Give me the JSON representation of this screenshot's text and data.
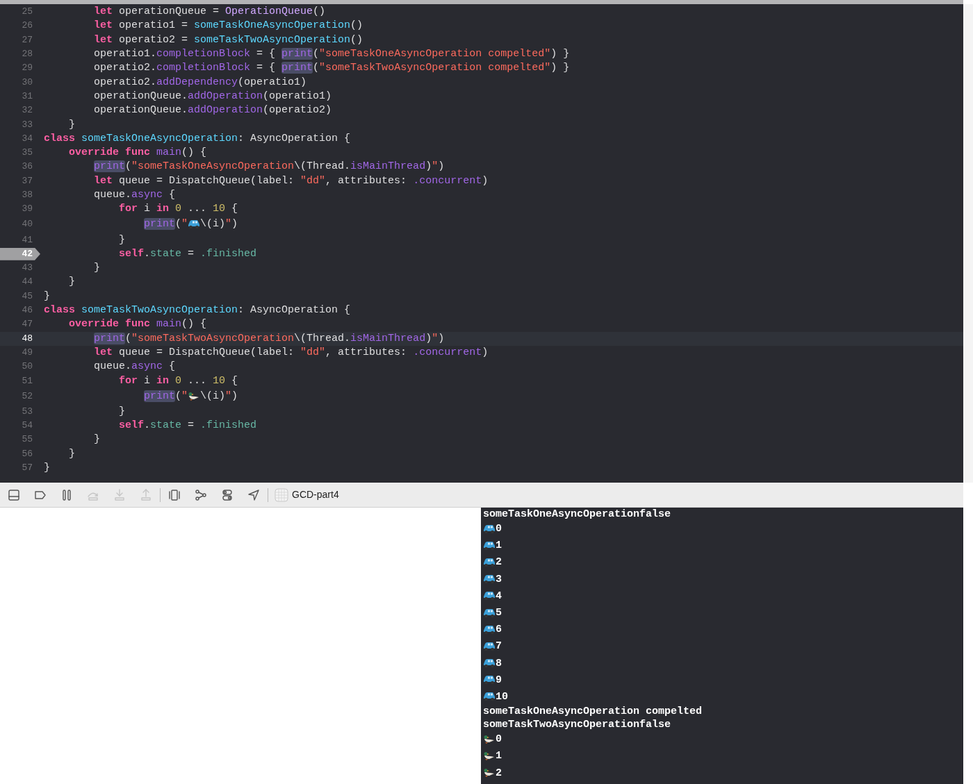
{
  "editor": {
    "lines": [
      {
        "number": "25",
        "breakpoint": false,
        "current": false,
        "tokens": [
          {
            "kind": "k",
            "text": "        let"
          },
          {
            "kind": "p",
            "text": " operationQueue = "
          },
          {
            "kind": "t",
            "text": "OperationQueue"
          },
          {
            "kind": "p",
            "text": "()"
          }
        ]
      },
      {
        "number": "26",
        "breakpoint": false,
        "current": false,
        "tokens": [
          {
            "kind": "k",
            "text": "        let"
          },
          {
            "kind": "p",
            "text": " operatio1 = "
          },
          {
            "kind": "d",
            "text": "someTaskOneAsyncOperation"
          },
          {
            "kind": "p",
            "text": "()"
          }
        ]
      },
      {
        "number": "27",
        "breakpoint": false,
        "current": false,
        "tokens": [
          {
            "kind": "k",
            "text": "        let"
          },
          {
            "kind": "p",
            "text": " operatio2 = "
          },
          {
            "kind": "d",
            "text": "someTaskTwoAsyncOperation"
          },
          {
            "kind": "p",
            "text": "()"
          }
        ]
      },
      {
        "number": "28",
        "breakpoint": false,
        "current": false,
        "tokens": [
          {
            "kind": "p",
            "text": "        operatio1."
          },
          {
            "kind": "f",
            "text": "completionBlock"
          },
          {
            "kind": "p",
            "text": " = { "
          },
          {
            "kind": "h",
            "text": "print"
          },
          {
            "kind": "p",
            "text": "("
          },
          {
            "kind": "s",
            "text": "\"someTaskOneAsyncOperation compelted\""
          },
          {
            "kind": "p",
            "text": ") }"
          }
        ]
      },
      {
        "number": "29",
        "breakpoint": false,
        "current": false,
        "tokens": [
          {
            "kind": "p",
            "text": "        operatio2."
          },
          {
            "kind": "f",
            "text": "completionBlock"
          },
          {
            "kind": "p",
            "text": " = { "
          },
          {
            "kind": "h",
            "text": "print"
          },
          {
            "kind": "p",
            "text": "("
          },
          {
            "kind": "s",
            "text": "\"someTaskTwoAsyncOperation compelted\""
          },
          {
            "kind": "p",
            "text": ") }"
          }
        ]
      },
      {
        "number": "30",
        "breakpoint": false,
        "current": false,
        "tokens": [
          {
            "kind": "p",
            "text": "        operatio2."
          },
          {
            "kind": "f",
            "text": "addDependency"
          },
          {
            "kind": "p",
            "text": "(operatio1)"
          }
        ]
      },
      {
        "number": "31",
        "breakpoint": false,
        "current": false,
        "tokens": [
          {
            "kind": "p",
            "text": "        operationQueue."
          },
          {
            "kind": "f",
            "text": "addOperation"
          },
          {
            "kind": "p",
            "text": "(operatio1)"
          }
        ]
      },
      {
        "number": "32",
        "breakpoint": false,
        "current": false,
        "tokens": [
          {
            "kind": "p",
            "text": "        operationQueue."
          },
          {
            "kind": "f",
            "text": "addOperation"
          },
          {
            "kind": "p",
            "text": "(operatio2)"
          }
        ]
      },
      {
        "number": "33",
        "breakpoint": false,
        "current": false,
        "tokens": [
          {
            "kind": "p",
            "text": "    }"
          }
        ]
      },
      {
        "number": "34",
        "breakpoint": false,
        "current": false,
        "tokens": [
          {
            "kind": "k",
            "text": "class"
          },
          {
            "kind": "d",
            "text": " someTaskOneAsyncOperation"
          },
          {
            "kind": "p",
            "text": ": AsyncOperation {"
          }
        ]
      },
      {
        "number": "35",
        "breakpoint": false,
        "current": false,
        "tokens": [
          {
            "kind": "k",
            "text": "    override func"
          },
          {
            "kind": "f",
            "text": " main"
          },
          {
            "kind": "p",
            "text": "() {"
          }
        ]
      },
      {
        "number": "36",
        "breakpoint": false,
        "current": false,
        "tokens": [
          {
            "kind": "h",
            "text": "        print"
          },
          {
            "kind": "p",
            "text": "("
          },
          {
            "kind": "s",
            "text": "\"someTaskOneAsyncOperation"
          },
          {
            "kind": "p",
            "text": "\\(Thread."
          },
          {
            "kind": "f",
            "text": "isMainThread"
          },
          {
            "kind": "p",
            "text": ")"
          },
          {
            "kind": "s",
            "text": "\""
          },
          {
            "kind": "p",
            "text": ")"
          }
        ]
      },
      {
        "number": "37",
        "breakpoint": false,
        "current": false,
        "tokens": [
          {
            "kind": "k",
            "text": "        let"
          },
          {
            "kind": "p",
            "text": " queue = DispatchQueue(label: "
          },
          {
            "kind": "s",
            "text": "\"dd\""
          },
          {
            "kind": "p",
            "text": ", attributes: "
          },
          {
            "kind": "f",
            "text": ".concurrent"
          },
          {
            "kind": "p",
            "text": ")"
          }
        ]
      },
      {
        "number": "38",
        "breakpoint": false,
        "current": false,
        "tokens": [
          {
            "kind": "p",
            "text": "        queue."
          },
          {
            "kind": "f",
            "text": "async"
          },
          {
            "kind": "p",
            "text": " {"
          }
        ]
      },
      {
        "number": "39",
        "breakpoint": false,
        "current": false,
        "tokens": [
          {
            "kind": "k",
            "text": "            for"
          },
          {
            "kind": "p",
            "text": " i "
          },
          {
            "kind": "k",
            "text": "in"
          },
          {
            "kind": "n",
            "text": " 0"
          },
          {
            "kind": "p",
            "text": " ... "
          },
          {
            "kind": "n",
            "text": "10"
          },
          {
            "kind": "p",
            "text": " {"
          }
        ]
      },
      {
        "number": "40",
        "breakpoint": false,
        "current": false,
        "tokens": [
          {
            "kind": "h",
            "text": "                print"
          },
          {
            "kind": "p",
            "text": "("
          },
          {
            "kind": "s",
            "text": "\""
          },
          {
            "kind": "car"
          },
          {
            "kind": "p",
            "text": "\\(i)"
          },
          {
            "kind": "s",
            "text": "\""
          },
          {
            "kind": "p",
            "text": ")"
          }
        ]
      },
      {
        "number": "41",
        "breakpoint": false,
        "current": false,
        "tokens": [
          {
            "kind": "p",
            "text": "            }"
          }
        ]
      },
      {
        "number": "42",
        "breakpoint": true,
        "current": false,
        "tokens": [
          {
            "kind": "k",
            "text": "            self"
          },
          {
            "kind": "p",
            "text": "."
          },
          {
            "kind": "v",
            "text": "state"
          },
          {
            "kind": "p",
            "text": " = "
          },
          {
            "kind": "v",
            "text": ".finished"
          }
        ]
      },
      {
        "number": "43",
        "breakpoint": false,
        "current": false,
        "tokens": [
          {
            "kind": "p",
            "text": "        }"
          }
        ]
      },
      {
        "number": "44",
        "breakpoint": false,
        "current": false,
        "tokens": [
          {
            "kind": "p",
            "text": "    }"
          }
        ]
      },
      {
        "number": "45",
        "breakpoint": false,
        "current": false,
        "tokens": [
          {
            "kind": "p",
            "text": "}"
          }
        ]
      },
      {
        "number": "46",
        "breakpoint": false,
        "current": false,
        "tokens": [
          {
            "kind": "k",
            "text": "class"
          },
          {
            "kind": "d",
            "text": " someTaskTwoAsyncOperation"
          },
          {
            "kind": "p",
            "text": ": AsyncOperation {"
          }
        ]
      },
      {
        "number": "47",
        "breakpoint": false,
        "current": false,
        "tokens": [
          {
            "kind": "k",
            "text": "    override func"
          },
          {
            "kind": "f",
            "text": " main"
          },
          {
            "kind": "p",
            "text": "() {"
          }
        ]
      },
      {
        "number": "48",
        "breakpoint": false,
        "current": true,
        "tokens": [
          {
            "kind": "h",
            "text": "        print"
          },
          {
            "kind": "p",
            "text": "("
          },
          {
            "kind": "s",
            "text": "\"someTaskTwoAsyncOperation"
          },
          {
            "kind": "p",
            "text": "\\(Thread."
          },
          {
            "kind": "f",
            "text": "isMainThread"
          },
          {
            "kind": "p",
            "text": ")"
          },
          {
            "kind": "s",
            "text": "\""
          },
          {
            "kind": "p",
            "text": ")"
          }
        ]
      },
      {
        "number": "49",
        "breakpoint": false,
        "current": false,
        "tokens": [
          {
            "kind": "k",
            "text": "        let"
          },
          {
            "kind": "p",
            "text": " queue = DispatchQueue(label: "
          },
          {
            "kind": "s",
            "text": "\"dd\""
          },
          {
            "kind": "p",
            "text": ", attributes: "
          },
          {
            "kind": "f",
            "text": ".concurrent"
          },
          {
            "kind": "p",
            "text": ")"
          }
        ]
      },
      {
        "number": "50",
        "breakpoint": false,
        "current": false,
        "tokens": [
          {
            "kind": "p",
            "text": "        queue."
          },
          {
            "kind": "f",
            "text": "async"
          },
          {
            "kind": "p",
            "text": " {"
          }
        ]
      },
      {
        "number": "51",
        "breakpoint": false,
        "current": false,
        "tokens": [
          {
            "kind": "k",
            "text": "            for"
          },
          {
            "kind": "p",
            "text": " i "
          },
          {
            "kind": "k",
            "text": "in"
          },
          {
            "kind": "n",
            "text": " 0"
          },
          {
            "kind": "p",
            "text": " ... "
          },
          {
            "kind": "n",
            "text": "10"
          },
          {
            "kind": "p",
            "text": " {"
          }
        ]
      },
      {
        "number": "52",
        "breakpoint": false,
        "current": false,
        "tokens": [
          {
            "kind": "h",
            "text": "                print"
          },
          {
            "kind": "p",
            "text": "("
          },
          {
            "kind": "s",
            "text": "\""
          },
          {
            "kind": "duck"
          },
          {
            "kind": "p",
            "text": "\\(i)"
          },
          {
            "kind": "s",
            "text": "\""
          },
          {
            "kind": "p",
            "text": ")"
          }
        ]
      },
      {
        "number": "53",
        "breakpoint": false,
        "current": false,
        "tokens": [
          {
            "kind": "p",
            "text": "            }"
          }
        ]
      },
      {
        "number": "54",
        "breakpoint": false,
        "current": false,
        "tokens": [
          {
            "kind": "k",
            "text": "            self"
          },
          {
            "kind": "p",
            "text": "."
          },
          {
            "kind": "v",
            "text": "state"
          },
          {
            "kind": "p",
            "text": " = "
          },
          {
            "kind": "v",
            "text": ".finished"
          }
        ]
      },
      {
        "number": "55",
        "breakpoint": false,
        "current": false,
        "tokens": [
          {
            "kind": "p",
            "text": "        }"
          }
        ]
      },
      {
        "number": "56",
        "breakpoint": false,
        "current": false,
        "tokens": [
          {
            "kind": "p",
            "text": "    }"
          }
        ]
      },
      {
        "number": "57",
        "breakpoint": false,
        "current": false,
        "tokens": [
          {
            "kind": "p",
            "text": "}"
          }
        ]
      }
    ]
  },
  "debug_bar": {
    "buttons": [
      {
        "kind": "panel",
        "disabled": false
      },
      {
        "kind": "label",
        "disabled": false
      },
      {
        "kind": "pause",
        "disabled": false
      },
      {
        "kind": "stepover",
        "disabled": true
      },
      {
        "kind": "stepin",
        "disabled": true
      },
      {
        "kind": "stepout",
        "disabled": true
      },
      {
        "kind": "divider"
      },
      {
        "kind": "view",
        "disabled": false
      },
      {
        "kind": "graph",
        "disabled": false
      },
      {
        "kind": "toggles",
        "disabled": false
      },
      {
        "kind": "location",
        "disabled": false
      },
      {
        "kind": "divider"
      }
    ],
    "target": "GCD-part4"
  },
  "console": {
    "lines": [
      {
        "kind": "text",
        "text": "someTaskOneAsyncOperationfalse"
      },
      {
        "kind": "car",
        "text": "0"
      },
      {
        "kind": "car",
        "text": "1"
      },
      {
        "kind": "car",
        "text": "2"
      },
      {
        "kind": "car",
        "text": "3"
      },
      {
        "kind": "car",
        "text": "4"
      },
      {
        "kind": "car",
        "text": "5"
      },
      {
        "kind": "car",
        "text": "6"
      },
      {
        "kind": "car",
        "text": "7"
      },
      {
        "kind": "car",
        "text": "8"
      },
      {
        "kind": "car",
        "text": "9"
      },
      {
        "kind": "car",
        "text": "10"
      },
      {
        "kind": "text",
        "text": "someTaskOneAsyncOperation compelted"
      },
      {
        "kind": "text",
        "text": "someTaskTwoAsyncOperationfalse"
      },
      {
        "kind": "duck",
        "text": "0"
      },
      {
        "kind": "duck",
        "text": "1"
      },
      {
        "kind": "duck",
        "text": "2"
      }
    ]
  }
}
